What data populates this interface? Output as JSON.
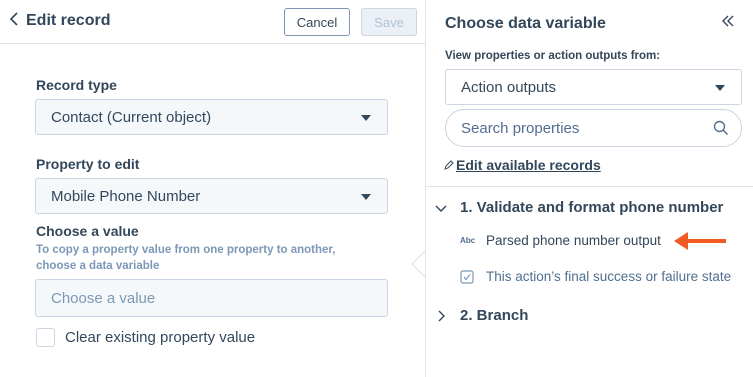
{
  "left_panel": {
    "header": {
      "back_icon": "chevron-left-icon",
      "title": "Edit record",
      "cancel_label": "Cancel",
      "save_label": "Save"
    },
    "record_type": {
      "label": "Record type",
      "value": "Contact (Current object)"
    },
    "property_to_edit": {
      "label": "Property to edit",
      "value": "Mobile Phone Number"
    },
    "choose_value": {
      "label": "Choose a value",
      "help": "To copy a property value from one property to another, choose a data variable",
      "placeholder": "Choose a value"
    },
    "clear_value": {
      "label": "Clear existing property value",
      "checked": false
    }
  },
  "right_panel": {
    "title": "Choose data variable",
    "collapse_icon": "double-chevron-left-icon",
    "source_label": "View properties or action outputs from:",
    "source_value": "Action outputs",
    "search_placeholder": "Search properties",
    "edit_link": "Edit available records",
    "groups": [
      {
        "title": "1. Validate and format phone number",
        "expanded": true,
        "items": [
          {
            "type_badge": "Abc",
            "label": "Parsed phone number output",
            "highlighted": true
          },
          {
            "type_icon": "checkbox-icon",
            "label": "This action’s final success or failure state",
            "highlighted": false
          }
        ]
      },
      {
        "title": "2. Branch",
        "expanded": false,
        "items": []
      }
    ]
  },
  "colors": {
    "text": "#33475b",
    "muted": "#7c98b6",
    "border": "#cbd6e2",
    "accent_arrow": "#f15a22"
  }
}
